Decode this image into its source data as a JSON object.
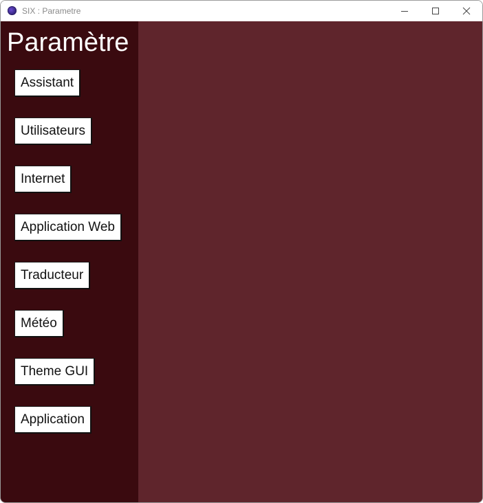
{
  "window": {
    "title": "SIX : Parametre"
  },
  "sidebar": {
    "title": "Paramètre",
    "items": [
      {
        "label": "Assistant"
      },
      {
        "label": "Utilisateurs"
      },
      {
        "label": "Internet"
      },
      {
        "label": "Application Web"
      },
      {
        "label": "Traducteur"
      },
      {
        "label": "Météo"
      },
      {
        "label": "Theme GUI"
      },
      {
        "label": "Application"
      }
    ]
  },
  "colors": {
    "sidebar_bg": "#3a0a0f",
    "main_bg": "#5f252c",
    "button_bg": "#ffffff",
    "title_text": "#ffffff"
  },
  "icons": {
    "app": "app-logo-icon",
    "minimize": "minimize-icon",
    "maximize": "maximize-icon",
    "close": "close-icon"
  }
}
